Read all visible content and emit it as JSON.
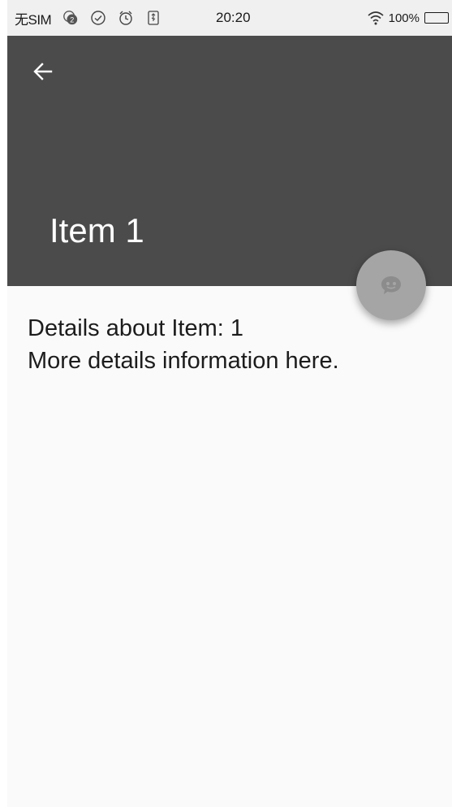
{
  "status_bar": {
    "carrier": "无SIM",
    "notification_badge": "2",
    "time": "20:20",
    "battery": "100%"
  },
  "app_bar": {
    "title": "Item 1",
    "background": "#4b4b4b",
    "back_icon": "arrow-back-icon"
  },
  "fab": {
    "icon": "chat-bubble-icon",
    "color": "#a5a5a5"
  },
  "content": {
    "line1": "Details about Item: 1",
    "line2": "More details information here."
  }
}
